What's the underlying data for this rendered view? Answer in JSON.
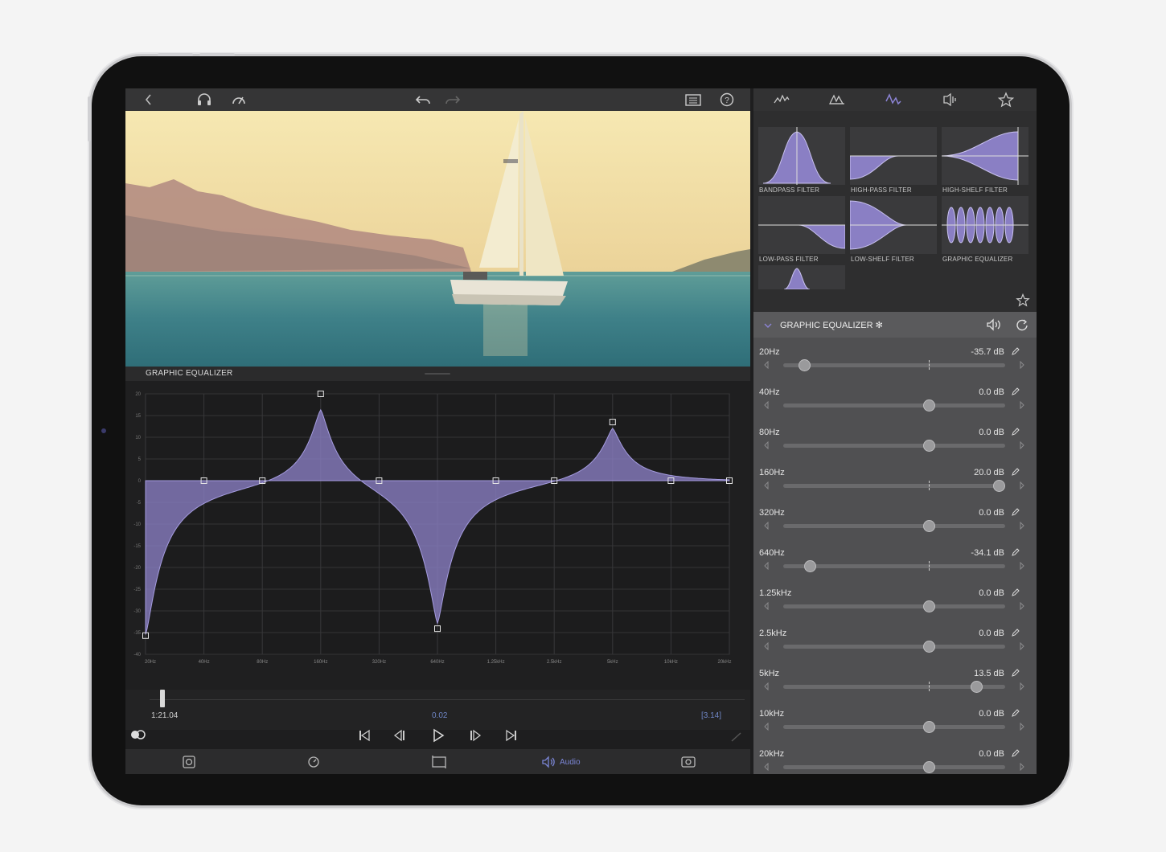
{
  "colors": {
    "accent": "#7b71c6",
    "eq_fill": "#8a7fc4",
    "panel_dark": "#1e1e1f",
    "band_bg": "#505052"
  },
  "icons": {
    "top_left": [
      "back-chevron-icon",
      "headphones-icon",
      "speed-gauge-icon"
    ],
    "top_center": [
      "undo-icon",
      "redo-icon"
    ],
    "top_right": [
      "clipboard-icon",
      "help-icon"
    ],
    "right_tabs": [
      "waveform-icon",
      "peaks-icon",
      "eq-curve-icon",
      "audio-unit-icon",
      "favorites-star-icon"
    ],
    "bottom": [
      "fx-icon",
      "speed-icon",
      "crop-icon",
      "audio-icon",
      "output-icon"
    ]
  },
  "editor": {
    "section_title": "GRAPHIC EQUALIZER"
  },
  "eq_graph": {
    "x_labels": [
      "20Hz",
      "40Hz",
      "80Hz",
      "160Hz",
      "320Hz",
      "640Hz",
      "1.25kHz",
      "2.5kHz",
      "5kHz",
      "10kHz",
      "20kHz"
    ],
    "y_labels": [
      "20",
      "15",
      "10",
      "5",
      "0",
      "-5",
      "-10",
      "-15",
      "-20",
      "-25",
      "-30",
      "-35",
      "-40"
    ],
    "y_range": [
      -40,
      20
    ],
    "gains": [
      -35.7,
      0.0,
      0.0,
      20.0,
      0.0,
      -34.1,
      0.0,
      0.0,
      13.5,
      0.0,
      0.0
    ]
  },
  "timeline": {
    "current_time": "1:21.04",
    "selection_length": "0.02",
    "total": "[3.14]"
  },
  "bottom_bar": {
    "audio_label": "Audio"
  },
  "presets": [
    {
      "label": "BANDPASS FILTER",
      "shape": "bandpass"
    },
    {
      "label": "HIGH-PASS FILTER",
      "shape": "highpass"
    },
    {
      "label": "HIGH-SHELF FILTER",
      "shape": "highshelf"
    },
    {
      "label": "LOW-PASS FILTER",
      "shape": "lowpass"
    },
    {
      "label": "LOW-SHELF FILTER",
      "shape": "lowshelf"
    },
    {
      "label": "GRAPHIC EQUALIZER",
      "shape": "graphic"
    }
  ],
  "eq_panel": {
    "title": "GRAPHIC EQUALIZER ✻",
    "bands": [
      {
        "freq": "20Hz",
        "db": "-35.7 dB",
        "value": -35.7
      },
      {
        "freq": "40Hz",
        "db": "0.0 dB",
        "value": 0.0
      },
      {
        "freq": "80Hz",
        "db": "0.0 dB",
        "value": 0.0
      },
      {
        "freq": "160Hz",
        "db": "20.0 dB",
        "value": 20.0
      },
      {
        "freq": "320Hz",
        "db": "0.0 dB",
        "value": 0.0
      },
      {
        "freq": "640Hz",
        "db": "-34.1 dB",
        "value": -34.1
      },
      {
        "freq": "1.25kHz",
        "db": "0.0 dB",
        "value": 0.0
      },
      {
        "freq": "2.5kHz",
        "db": "0.0 dB",
        "value": 0.0
      },
      {
        "freq": "5kHz",
        "db": "13.5 dB",
        "value": 13.5
      },
      {
        "freq": "10kHz",
        "db": "0.0 dB",
        "value": 0.0
      },
      {
        "freq": "20kHz",
        "db": "0.0 dB",
        "value": 0.0
      }
    ]
  }
}
